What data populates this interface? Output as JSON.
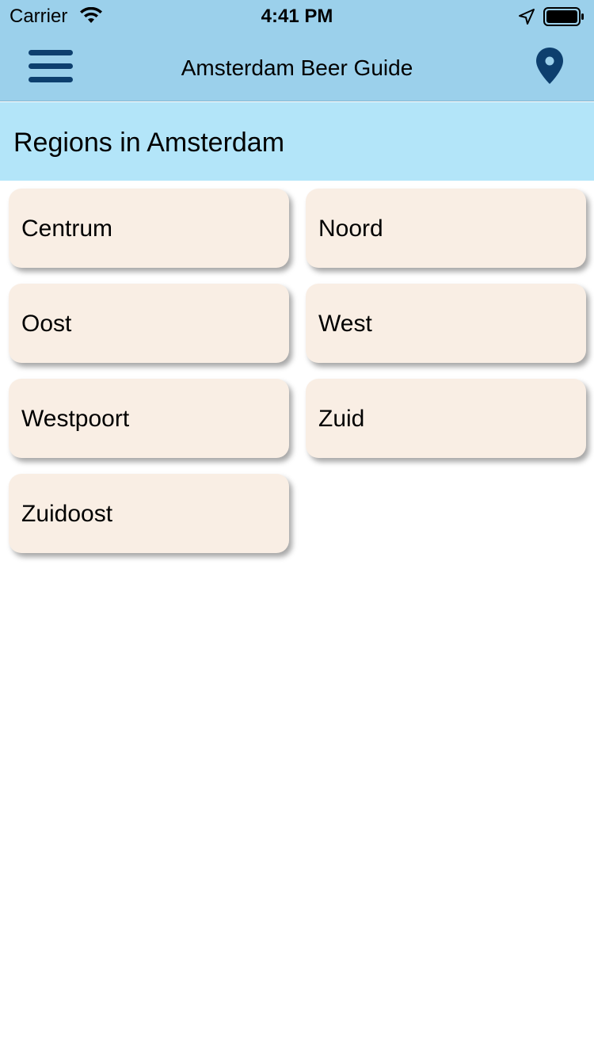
{
  "status_bar": {
    "carrier": "Carrier",
    "time": "4:41 PM",
    "icons": [
      "wifi-icon",
      "location-arrow-icon",
      "battery-icon"
    ]
  },
  "nav_bar": {
    "title": "Amsterdam Beer Guide",
    "left_icon": "menu-icon",
    "right_icon": "map-pin-icon"
  },
  "section": {
    "title": "Regions in Amsterdam"
  },
  "regions": [
    {
      "label": "Centrum"
    },
    {
      "label": "Noord"
    },
    {
      "label": "Oost"
    },
    {
      "label": "West"
    },
    {
      "label": "Westpoort"
    },
    {
      "label": "Zuid"
    },
    {
      "label": "Zuidoost"
    }
  ],
  "colors": {
    "nav_background": "#9bd0eb",
    "section_background": "#b3e5f9",
    "card_background": "#f9eee4",
    "icon_accent": "#0d3f6e"
  }
}
